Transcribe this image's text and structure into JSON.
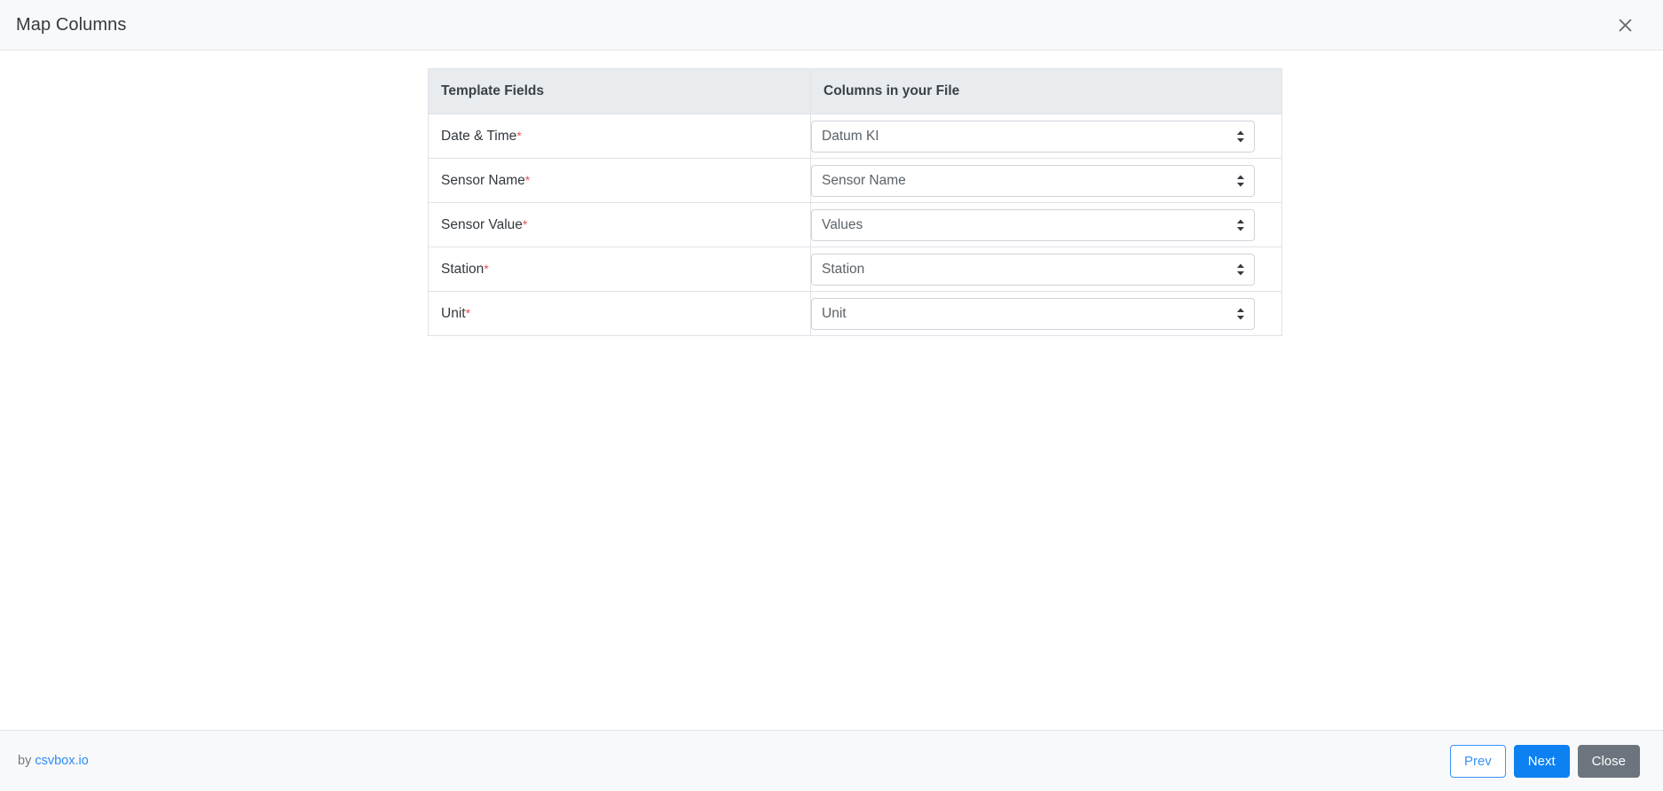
{
  "header": {
    "title": "Map Columns",
    "close_icon": "close-icon"
  },
  "table": {
    "columns": [
      "Template Fields",
      "Columns in your File"
    ],
    "required_marker": "*",
    "rows": [
      {
        "field": "Date & Time",
        "required": true,
        "selected": "Datum KI"
      },
      {
        "field": "Sensor Name",
        "required": true,
        "selected": "Sensor Name"
      },
      {
        "field": "Sensor Value",
        "required": true,
        "selected": "Values"
      },
      {
        "field": "Station",
        "required": true,
        "selected": "Station"
      },
      {
        "field": "Unit",
        "required": true,
        "selected": "Unit"
      }
    ]
  },
  "footer": {
    "credit_prefix": "by ",
    "credit_link": "csvbox.io",
    "prev_label": "Prev",
    "next_label": "Next",
    "close_label": "Close"
  },
  "colors": {
    "accent": "#0d80f2",
    "link": "#2d8cf8",
    "required": "#e8505b",
    "chrome": "#f8f9fa",
    "table_header": "#e9ecef",
    "secondary": "#6c757d"
  }
}
